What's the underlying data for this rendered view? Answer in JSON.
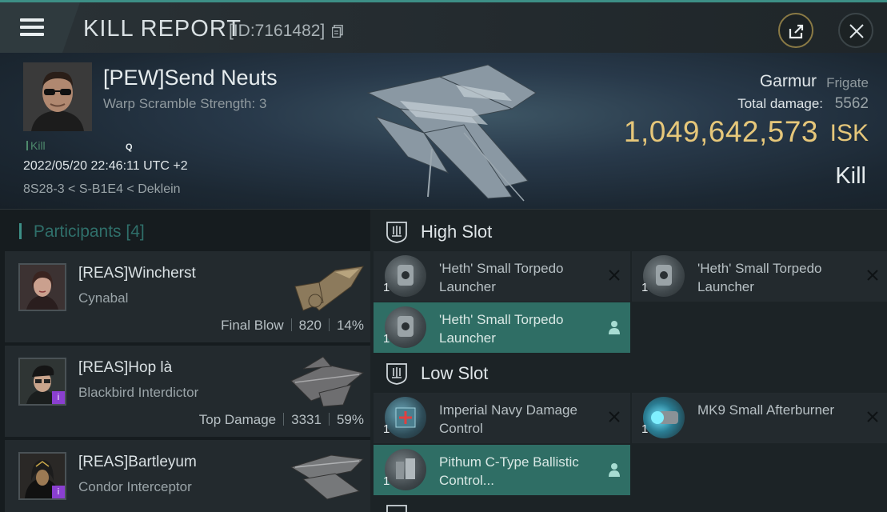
{
  "header": {
    "title": "KILL REPORT",
    "report_id": "[ID:7161482]"
  },
  "victim": {
    "name": "[PEW]Send Neuts",
    "subtitle": "Warp Scramble Strength: 3",
    "kill_tag": "Kill",
    "q_tag": "Q",
    "datetime": "2022/05/20 22:46:11 UTC +2",
    "location": "8S28-3 < S-B1E4 < Deklein",
    "ship_name": "Garmur",
    "ship_class": "Frigate",
    "total_damage_label": "Total damage:",
    "total_damage": "5562",
    "isk_value": "1,049,642,573",
    "isk_unit": "ISK",
    "result": "Kill"
  },
  "participants": {
    "label": "Participants",
    "count": "[4]",
    "rows": [
      {
        "name": "[REAS]Wincherst",
        "ship": "Cynabal",
        "stat_label": "Final Blow",
        "damage": "820",
        "percent": "14%"
      },
      {
        "name": "[REAS]Hop là",
        "ship": "Blackbird Interdictor",
        "stat_label": "Top Damage",
        "damage": "3331",
        "percent": "59%"
      },
      {
        "name": "[REAS]Bartleyum",
        "ship": "Condor Interceptor",
        "stat_label": "",
        "damage": "",
        "percent": ""
      }
    ]
  },
  "fitting": {
    "high_slot": {
      "label": "High Slot",
      "items": [
        {
          "qty": "1",
          "name": "'Heth' Small Torpedo Launcher",
          "status": "destroyed"
        },
        {
          "qty": "1",
          "name": "'Heth' Small Torpedo Launcher",
          "status": "destroyed"
        },
        {
          "qty": "1",
          "name": "'Heth' Small Torpedo Launcher",
          "status": "dropped"
        }
      ]
    },
    "low_slot": {
      "label": "Low Slot",
      "items": [
        {
          "qty": "1",
          "name": "Imperial Navy Damage Control",
          "status": "destroyed"
        },
        {
          "qty": "1",
          "name": "MK9 Small Afterburner",
          "status": "destroyed"
        },
        {
          "qty": "1",
          "name": "Pithum C-Type Ballistic Control...",
          "status": "dropped"
        }
      ]
    }
  },
  "colors": {
    "accent": "#3d8f86",
    "isk": "#e6c77a",
    "dropped_bg": "#2f6e65"
  },
  "icons": [
    "menu-icon",
    "copy-icon",
    "share-icon",
    "close-icon",
    "high-slot-icon",
    "low-slot-icon",
    "destroyed-x-icon",
    "dropped-person-icon"
  ]
}
